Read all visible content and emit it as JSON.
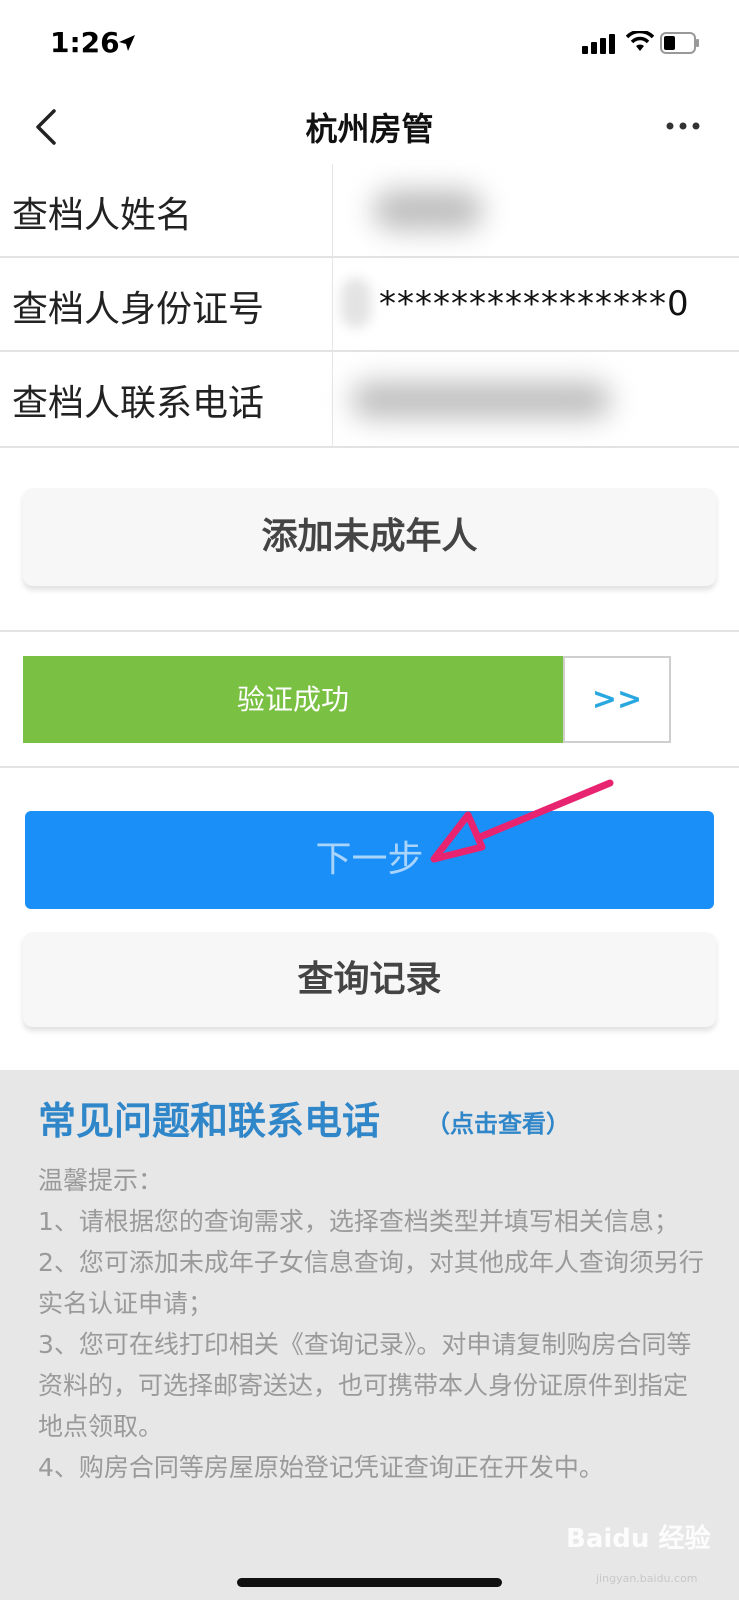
{
  "status_bar": {
    "time": "1:26"
  },
  "nav": {
    "title": "杭州房管"
  },
  "form": {
    "rows": [
      {
        "label": "查档人姓名"
      },
      {
        "label": "查档人身份证号",
        "value": "****************0"
      },
      {
        "label": "查档人联系电话"
      }
    ]
  },
  "buttons": {
    "add_minor": "添加未成年人",
    "verify_status": "验证成功",
    "verify_arrow": ">>",
    "next": "下一步",
    "query_records": "查询记录"
  },
  "faq": {
    "title": "常见问题和联系电话",
    "link": "（点击查看）",
    "tips_heading": "温馨提示：",
    "tips": [
      "1、请根据您的查询需求，选择查档类型并填写相关信息；",
      "2、您可添加未成年子女信息查询，对其他成年人查询须另行实名认证申请；",
      "3、您可在线打印相关《查询记录》。对申请复制购房合同等资料的，可选择邮寄送达，也可携带本人身份证原件到指定地点领取。",
      "4、购房合同等房屋原始登记凭证查询正在开发中。"
    ]
  },
  "watermark": {
    "text": "Baidu 经验",
    "sub": "jingyan.baidu.com"
  },
  "colors": {
    "verify_green": "#7ac143",
    "next_blue": "#1a8ff8",
    "faq_blue": "#2f86c9",
    "annotation_pink": "#e8236f"
  },
  "icons": [
    "location-arrow-icon",
    "signal-icon",
    "wifi-icon",
    "battery-icon",
    "back-chevron-icon",
    "more-dots-icon"
  ]
}
